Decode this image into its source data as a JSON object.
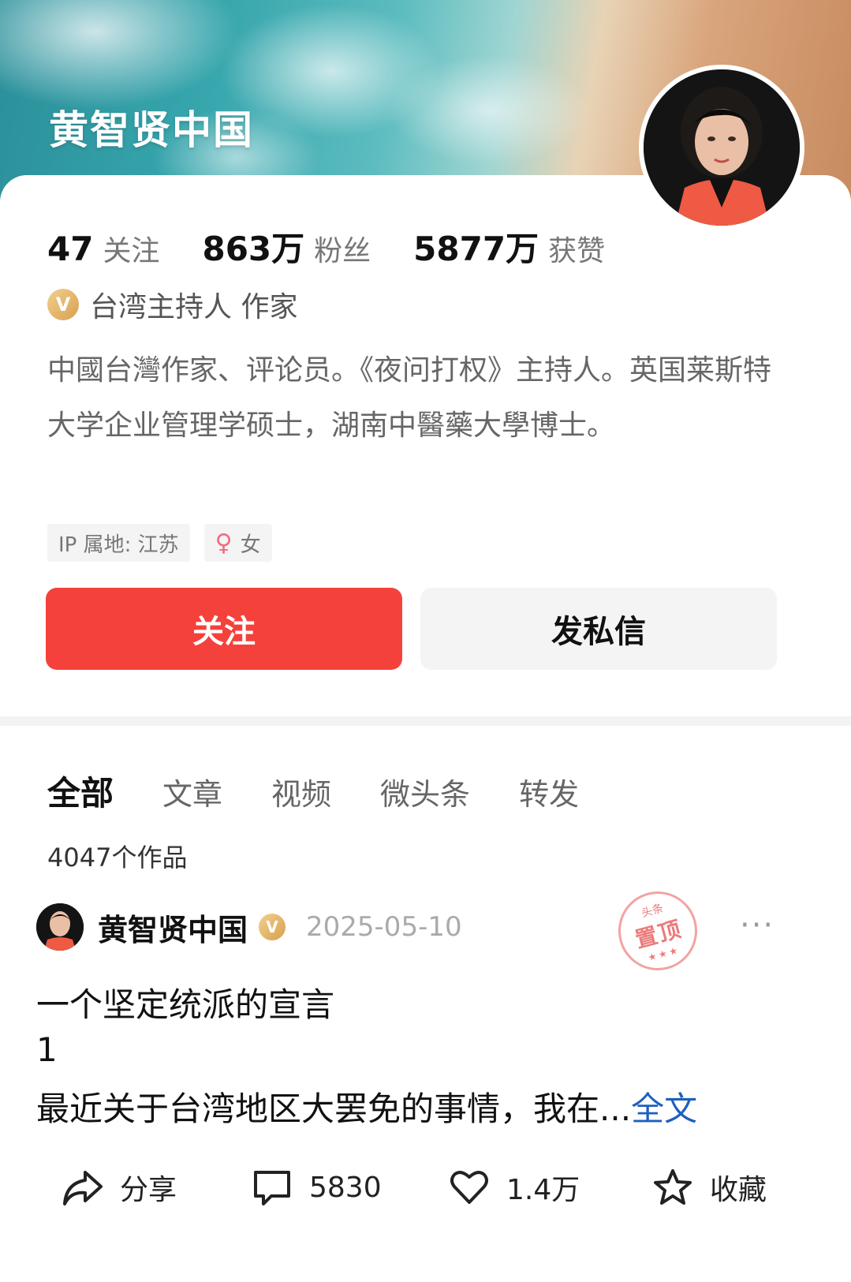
{
  "profile": {
    "name": "黄智贤中国",
    "stats": [
      {
        "num": "47",
        "label": "关注"
      },
      {
        "num": "863万",
        "label": "粉丝"
      },
      {
        "num": "5877万",
        "label": "获赞"
      }
    ],
    "verify_badge": "V",
    "verify_text": "台湾主持人 作家",
    "bio": "中國台灣作家、评论员。《夜问打权》主持人。英国莱斯特大学企业管理学硕士，湖南中醫藥大學博士。",
    "ip_tag": "IP 属地: 江苏",
    "gender_tag": "女",
    "follow_label": "关注",
    "message_label": "发私信"
  },
  "tabs": [
    {
      "label": "全部"
    },
    {
      "label": "文章"
    },
    {
      "label": "视频"
    },
    {
      "label": "微头条"
    },
    {
      "label": "转发"
    }
  ],
  "work_count": "4047个作品",
  "post": {
    "author": "黄智贤中国",
    "verify_badge": "V",
    "date": "2025-05-10",
    "pin_small": "头条",
    "pin_big": "置顶",
    "more": "···",
    "title": "一个坚定统派的宣言",
    "number": "1",
    "excerpt": "最近关于台湾地区大罢免的事情，我在...",
    "read_full": "全文"
  },
  "actions": [
    {
      "icon": "share-icon",
      "label": "分享"
    },
    {
      "icon": "comment-icon",
      "label": "5830"
    },
    {
      "icon": "heart-icon",
      "label": "1.4万"
    },
    {
      "icon": "star-icon",
      "label": "收藏"
    }
  ],
  "colors": {
    "accent_red": "#f5413b",
    "link_blue": "#1f5fbf",
    "verify_gold": "#d7a04f"
  }
}
